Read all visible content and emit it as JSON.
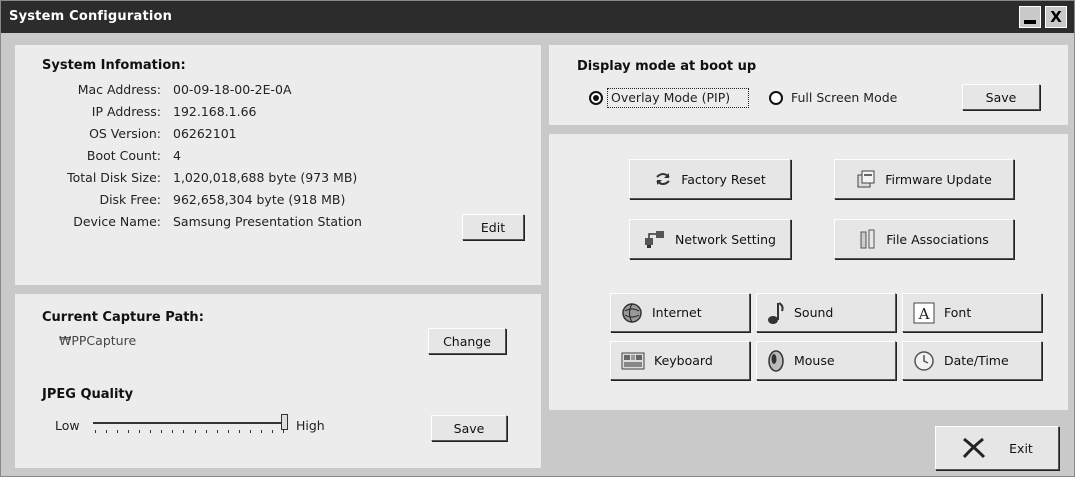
{
  "window": {
    "title": "System Configuration",
    "minimize_icon": "minimize-icon",
    "close_label": "X"
  },
  "system_info": {
    "heading": "System Infomation:",
    "rows": [
      {
        "label": "Mac Address:",
        "value": "00-09-18-00-2E-0A"
      },
      {
        "label": "IP Address:",
        "value": "192.168.1.66"
      },
      {
        "label": "OS Version:",
        "value": "06262101"
      },
      {
        "label": "Boot Count:",
        "value": "4"
      },
      {
        "label": "Total Disk Size:",
        "value": "1,020,018,688 byte (973 MB)"
      },
      {
        "label": "Disk Free:",
        "value": "962,658,304 byte (918 MB)"
      },
      {
        "label": "Device Name:",
        "value": "Samsung Presentation Station"
      }
    ],
    "edit_label": "Edit"
  },
  "capture": {
    "heading": "Current Capture Path:",
    "path": "₩PPCapture",
    "change_label": "Change"
  },
  "jpeg": {
    "heading": "JPEG Quality",
    "low_label": "Low",
    "high_label": "High",
    "level": 1.0,
    "save_label": "Save"
  },
  "display_mode": {
    "heading": "Display mode at boot up",
    "options": [
      {
        "label": "Overlay Mode (PIP)",
        "selected": true
      },
      {
        "label": "Full Screen Mode",
        "selected": false
      }
    ],
    "save_label": "Save"
  },
  "tools": {
    "factory_reset": {
      "label": "Factory Reset",
      "icon": "refresh-arrows-icon"
    },
    "firmware_update": {
      "label": "Firmware Update",
      "icon": "firmware-icon"
    },
    "network_setting": {
      "label": "Network Setting",
      "icon": "network-icon"
    },
    "file_associations": {
      "label": "File Associations",
      "icon": "file-associations-icon"
    }
  },
  "controls": {
    "internet": {
      "label": "Internet",
      "icon": "globe-icon"
    },
    "sound": {
      "label": "Sound",
      "icon": "music-note-icon"
    },
    "font": {
      "label": "Font",
      "icon": "font-icon"
    },
    "keyboard": {
      "label": "Keyboard",
      "icon": "keyboard-icon"
    },
    "mouse": {
      "label": "Mouse",
      "icon": "mouse-icon"
    },
    "datetime": {
      "label": "Date/Time",
      "icon": "clock-icon"
    }
  },
  "exit": {
    "label": "Exit",
    "icon": "exit-x-icon"
  }
}
